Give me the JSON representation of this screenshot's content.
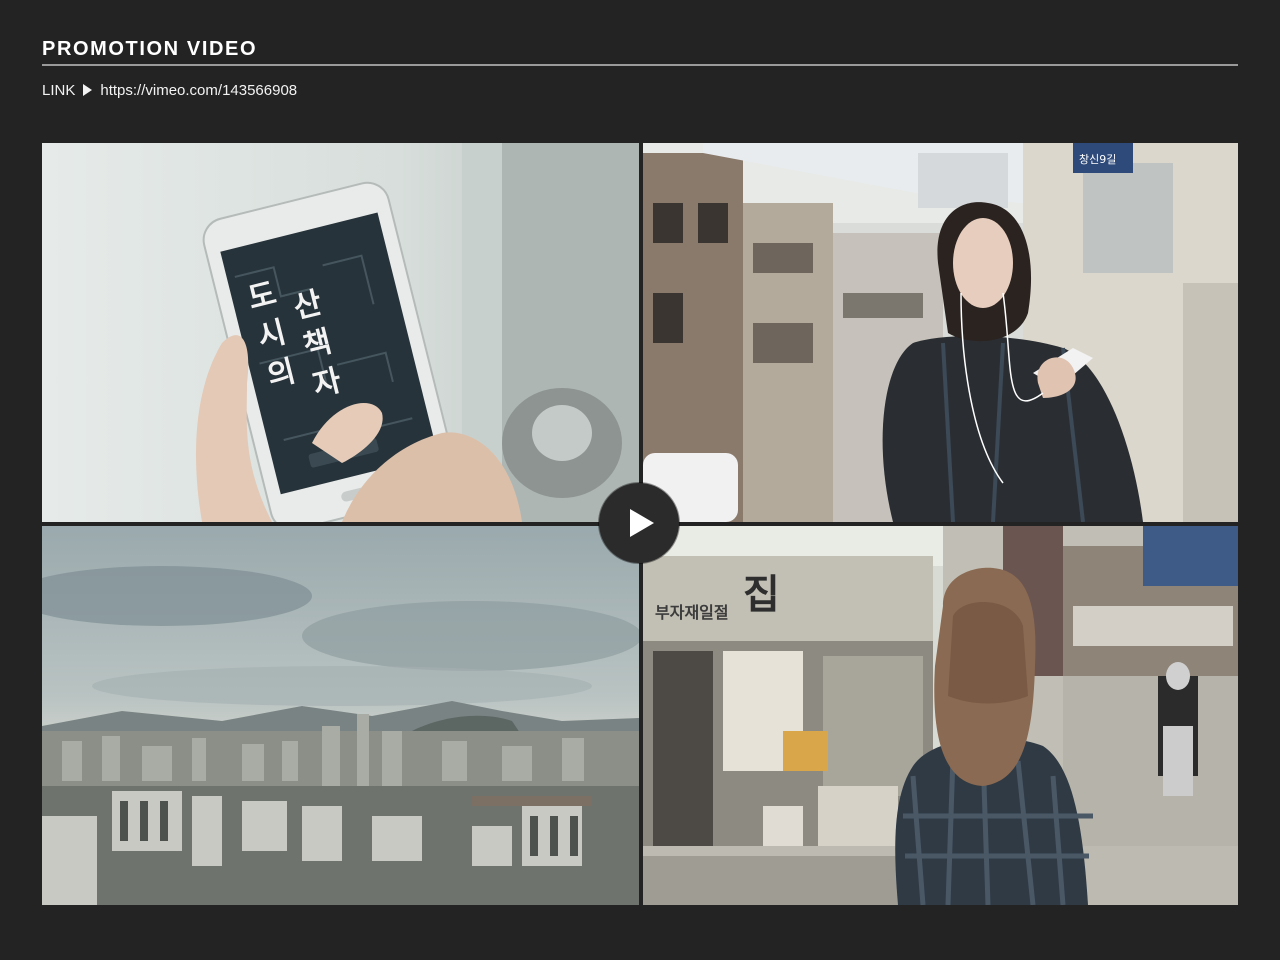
{
  "header": {
    "title": "PROMOTION VIDEO",
    "link_label": "LINK",
    "link_icon": "play-triangle-icon",
    "link_url": "https://vimeo.com/143566908"
  },
  "video": {
    "play_icon": "play-icon",
    "frames": [
      {
        "name": "phone-app-frame",
        "app_title_lines": [
          "도시",
          "산책",
          "의",
          "자"
        ],
        "app_login": "로그인"
      },
      {
        "name": "woman-street-frame",
        "street_sign": "창신9길"
      },
      {
        "name": "city-skyline-frame"
      },
      {
        "name": "alley-walk-frame",
        "shop_sign": "부자재일절",
        "shop_sign_big": "집"
      }
    ]
  },
  "colors": {
    "background": "#232323",
    "rule": "#9a9a9a",
    "text": "#ffffff",
    "play_bg": "#2b2b2b"
  }
}
